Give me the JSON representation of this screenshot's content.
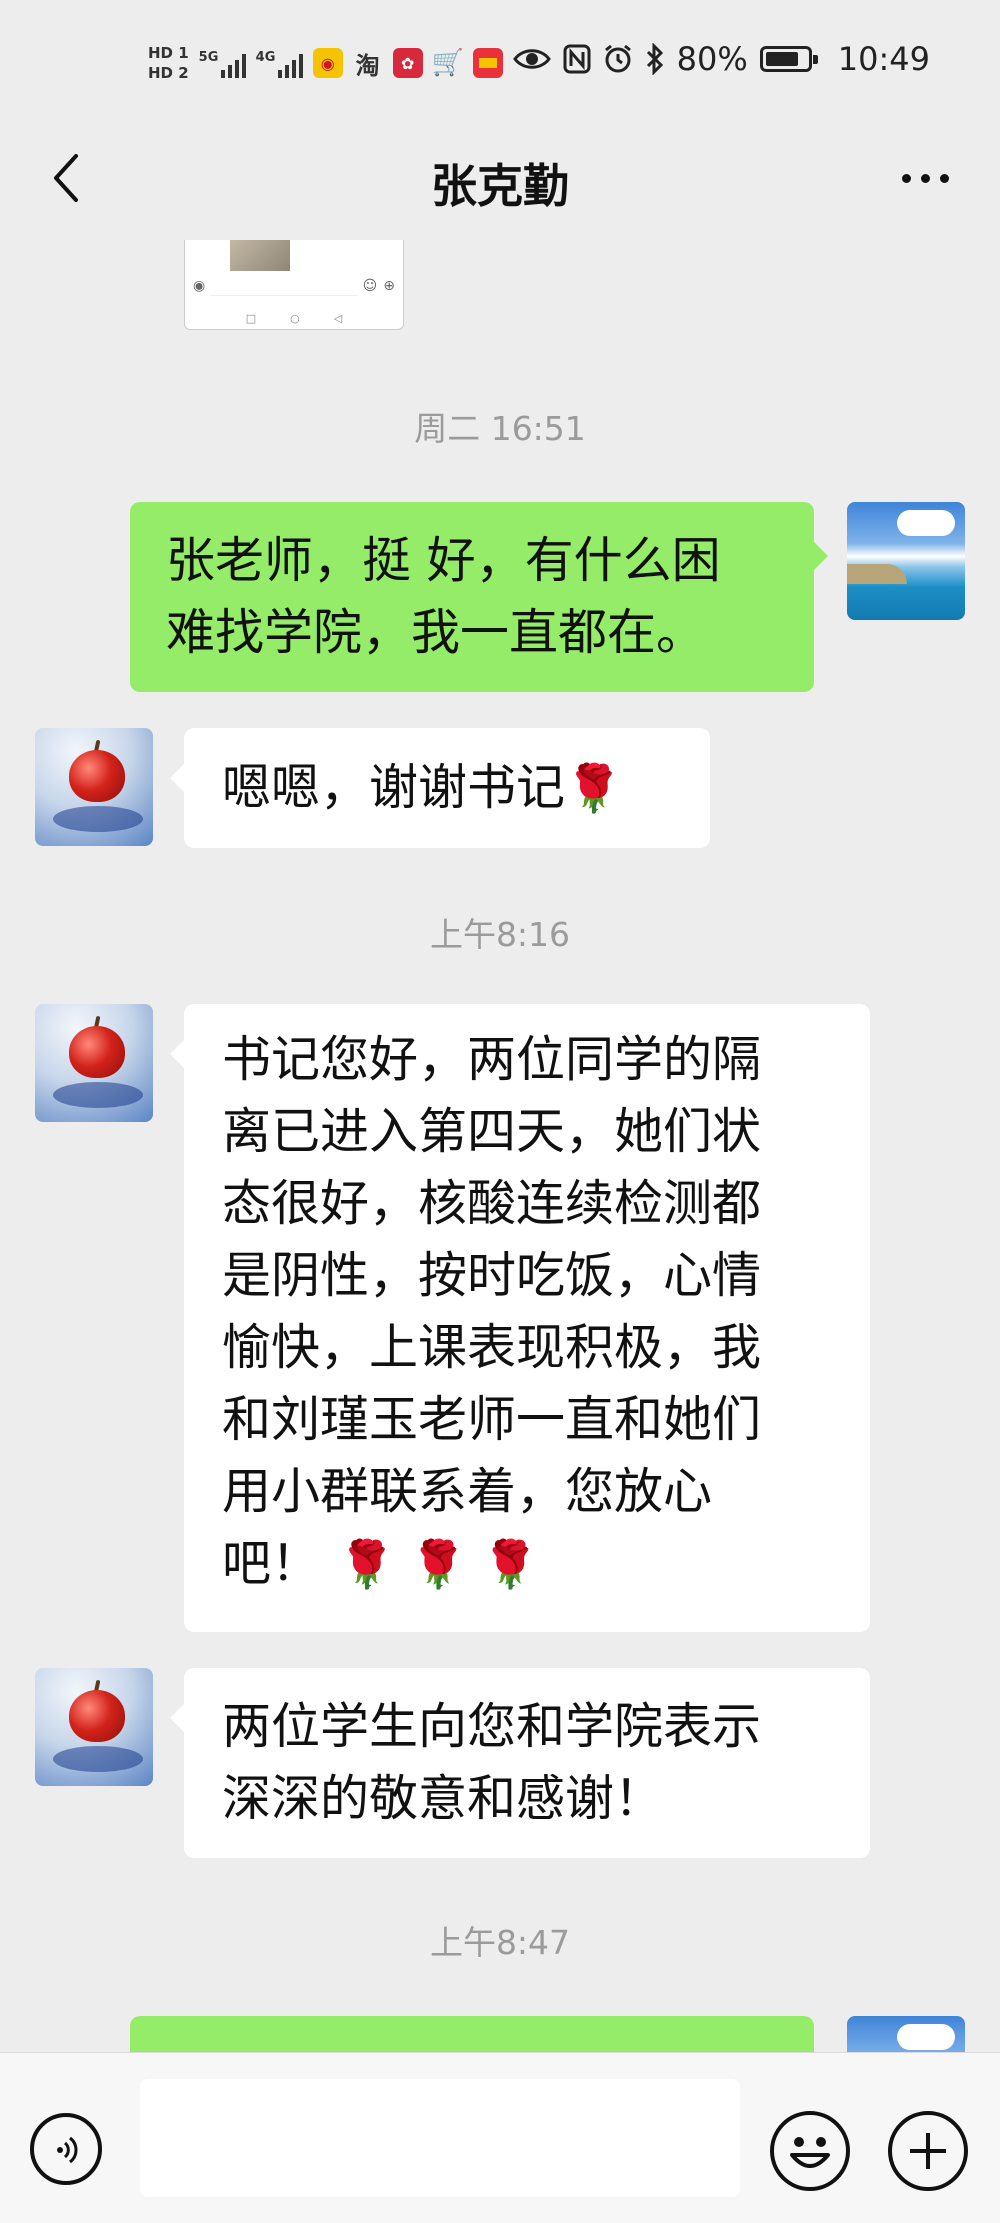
{
  "status_bar": {
    "hd1": "HD 1",
    "hd2": "HD 2",
    "network1": "5G",
    "network2": "4G",
    "taobao_glyph": "淘",
    "battery_percent": "80%",
    "battery_level": 0.8,
    "time": "10:49",
    "icons": [
      "weibo-icon",
      "taobao-icon",
      "lotus-app-icon",
      "cart-icon",
      "notes-app-icon",
      "eye-icon",
      "nfc-icon",
      "alarm-icon",
      "bluetooth-icon"
    ]
  },
  "header": {
    "title": "张克勤",
    "back_icon": "chevron-left-icon",
    "more_icon": "more-dots-icon"
  },
  "chat": {
    "timestamps": [
      "周二 16:51",
      "上午8:16",
      "上午8:47"
    ],
    "messages": [
      {
        "side": "right",
        "text": "张老师，挺 好，有什么困\n难找学院，我一直都在。"
      },
      {
        "side": "left",
        "text": "嗯嗯，谢谢书记",
        "emoji": "🌹"
      },
      {
        "side": "left",
        "text": "书记您好，两位同学的隔\n离已进入第四天，她们状\n态很好，核酸连续检测都\n是阴性，按时吃饭，心情\n愉快，上课表现积极，我\n和刘瑾玉老师一直和她们\n用小群联系着，您放心\n吧！",
        "emoji": "🌹 🌹 🌹"
      },
      {
        "side": "left",
        "text": "两位学生向您和学院表示\n深深的敬意和感谢！"
      }
    ]
  },
  "input_bar": {
    "voice_icon": "voice-icon",
    "emoji_icon": "emoji-icon",
    "plus_icon": "plus-icon",
    "value": ""
  },
  "colors": {
    "background": "#ededed",
    "bubble_self": "#95ec69",
    "bubble_other": "#ffffff",
    "timestamp": "#9b9b9b"
  }
}
